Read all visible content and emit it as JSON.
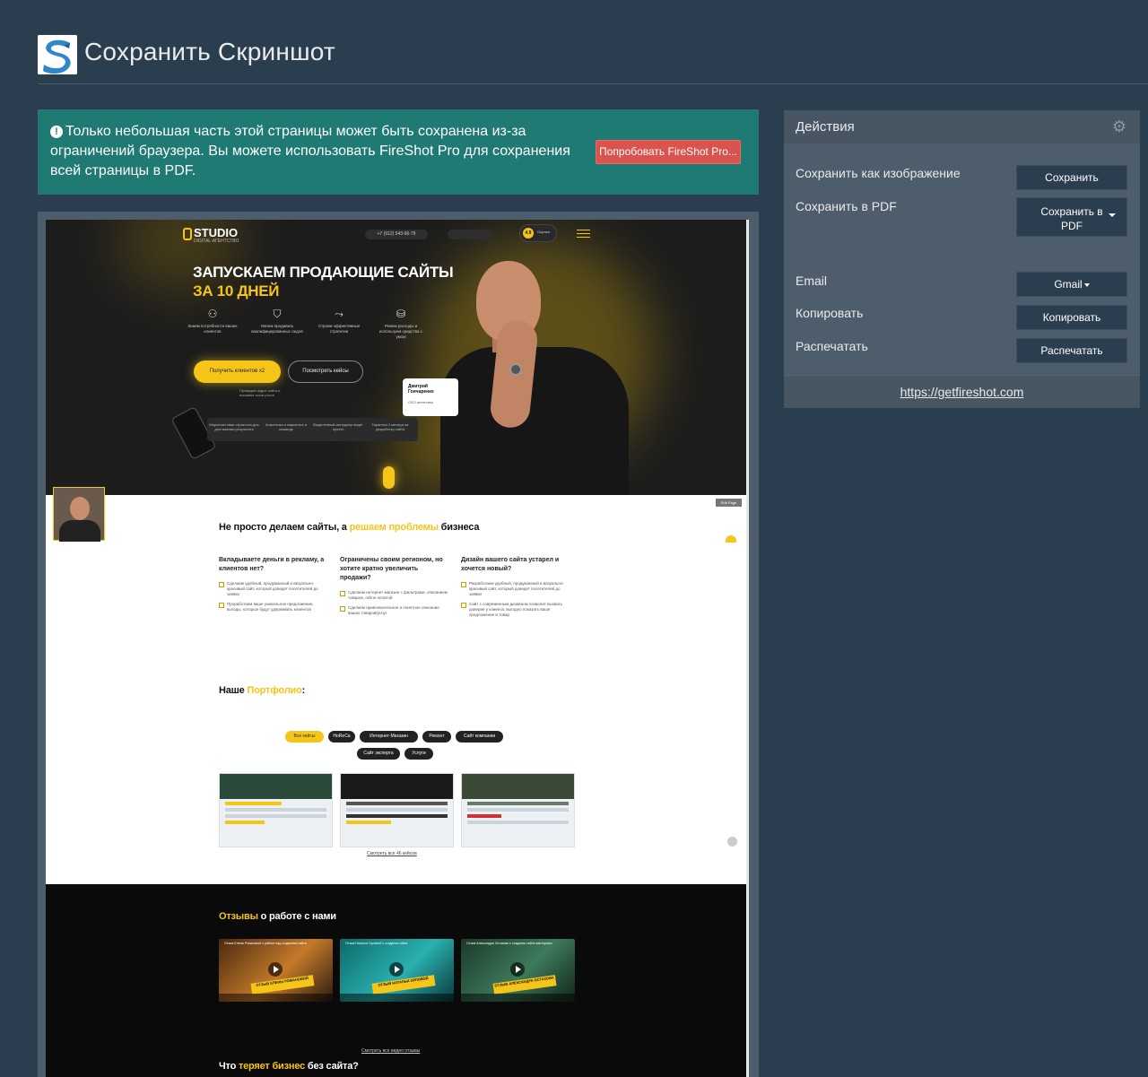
{
  "header": {
    "title": "Сохранить Скриншот"
  },
  "alert": {
    "text": "Только небольшая часть этой страницы может быть сохранена из-за ограничений браузера. Вы можете использовать FireShot Pro для сохранения всей страницы в PDF.",
    "button": "Попробовать FireShot Pro..."
  },
  "actions": {
    "title": "Действия",
    "rows": [
      {
        "label": "Сохранить как изображение",
        "button": "Сохранить"
      },
      {
        "label": "Сохранить в PDF",
        "button": "Сохранить в PDF"
      },
      {
        "label": "Email",
        "button": "Gmail"
      },
      {
        "label": "Копировать",
        "button": "Копировать"
      },
      {
        "label": "Распечатать",
        "button": "Распечатать"
      }
    ],
    "footer_link": "https://getfireshot.com"
  },
  "preview": {
    "brand": "STUDIO",
    "brand_sub": "DIGITAL-АГЕНТСТВО",
    "phone": "+7 (912) 543-96-79",
    "rating": "4.9",
    "rating_label": "Оценка",
    "hero_title_line1": "ЗАПУСКАЕМ ПРОДАЮЩИЕ САЙТЫ",
    "hero_title_line2": "ЗА 10 ДНЕЙ",
    "features": [
      "Знаем потребности ваших клиентов",
      "Умеем продавать квалифицированных лидов",
      "Строим эффективные стратегии",
      "Режем расходы и используем средства с умом"
    ],
    "cta_primary": "Получить клиентов x2",
    "cta_secondary": "Посмотреть кейсы",
    "hero_note": "Проведем аудит сайта и покажем точки роста",
    "stats": [
      "Маркетинговая стратегия для достижения результата",
      "Аналитика и маркетинг в команде",
      "Выделенный менеджер ведет проект",
      "Гарантия 2 месяца на разработку сайта"
    ],
    "person_name": "Дмитрий Гончаренко",
    "person_role": "CEO агентства",
    "edit_tag": "Edit Page",
    "problems_title_pre": "Не просто делаем сайты, а ",
    "problems_title_hl": "решаем проблемы",
    "problems_title_post": " бизнеса",
    "problems": [
      {
        "title": "Вкладываете деньги в рекламу, а клиентов нет?",
        "points": [
          "Сделаем удобный, продуманный и визуально-красивый сайт, который доведет посетителей до заявки",
          "Проработаем ваше уникальное предложение, выгоды, которые будут удерживать клиентов"
        ]
      },
      {
        "title": "Ограничены своим регионом, но хотите кратно увеличить продажи?",
        "points": [
          "Сделаем интернет-магазин с фильтрами, описанием товаров, online оплатой",
          "Сделаем привлекательное и понятное описание ваших товаров/услуг"
        ]
      },
      {
        "title": "Дизайн вашего сайта устарел и хочется новый?",
        "points": [
          "Разработаем удобный, продуманный и визуально-красивый сайт, который доведет посетителей до заявки",
          "Сайт с современным дизайном позволит вызвать доверие у клиента, выгодно показать ваше предложение и товар"
        ]
      }
    ],
    "portfolio_title_pre": "Наше ",
    "portfolio_title_hl": "Портфолио",
    "portfolio_title_post": ":",
    "filters": [
      "Все кейсы",
      "HoReCa",
      "Интернет-Магазин",
      "Ремонт",
      "Сайт компании",
      "Сайт эксперта",
      "Услуги"
    ],
    "see_all_cases": "Смотреть все 46 кейсов",
    "reviews_title_hl": "Отзывы",
    "reviews_title_post": " о работе с нами",
    "videos": [
      {
        "caption": "Отзыв Елены Романовой о работе над созданием сайта",
        "banner": "ОТЗЫВ ЕЛЕНЫ РОМАНОВОЙ"
      },
      {
        "caption": "Отзыв Натальи Орловой о создании сайта",
        "banner": "ОТЗЫВ НАТАЛЬИ ОРЛОВОЙ"
      },
      {
        "caption": "Отзыв Александра Остахова о создании сайта мастерских",
        "banner": "ОТЗЫВ АЛЕКСАНДРА ОСТАХОВА"
      }
    ],
    "see_all_videos": "Смотреть все видео отзывы",
    "bottom_title_pre": "Что ",
    "bottom_title_hl": "теряет бизнес",
    "bottom_title_post": " без сайта?"
  },
  "colors": {
    "background": "#2b3e50",
    "panel": "#4e5d6c",
    "alert": "#1f7a73",
    "danger": "#d9534f",
    "accent_yellow": "#f5c518"
  }
}
